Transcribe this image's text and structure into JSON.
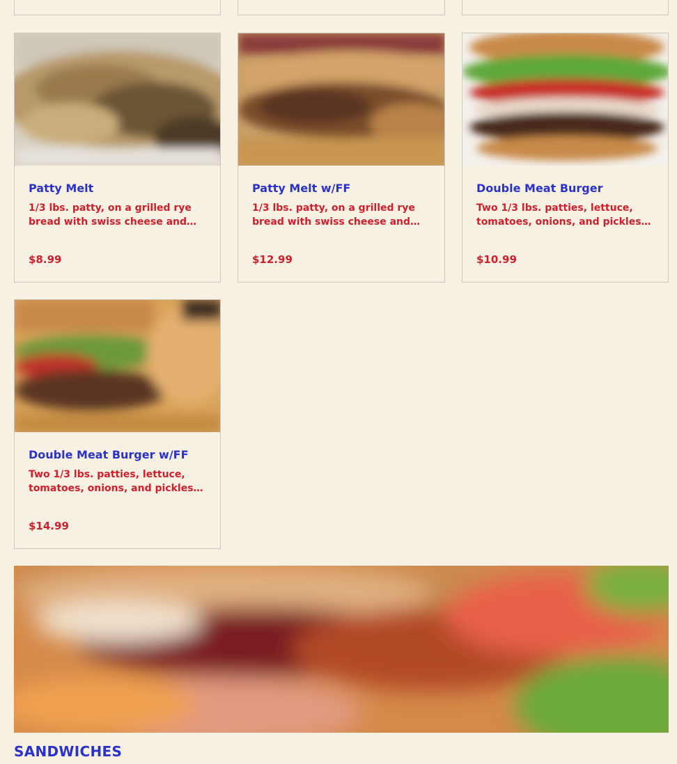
{
  "items": [
    {
      "name": "Patty Melt",
      "description": "1/3 lbs. patty, on a grilled rye bread with swiss cheese and grilled onions.",
      "price": "$8.99",
      "image": "patty-melt-photo"
    },
    {
      "name": "Patty Melt w/FF",
      "description": "1/3 lbs. patty, on a grilled rye bread with swiss cheese and grilled onions.",
      "price": "$12.99",
      "image": "patty-melt-fries-photo"
    },
    {
      "name": "Double Meat Burger",
      "description": "Two 1/3 lbs. patties, lettuce, tomatoes, onions, and pickles on a bun.",
      "price": "$10.99",
      "image": "double-meat-burger-photo"
    },
    {
      "name": "Double Meat Burger w/FF",
      "description": "Two 1/3 lbs. patties, lettuce, tomatoes, onions, and pickles on a bun.",
      "price": "$14.99",
      "image": "double-meat-burger-fries-photo"
    }
  ],
  "section": {
    "title": "SANDWICHES",
    "banner_image": "sandwich-banner-photo"
  },
  "colors": {
    "background": "#f7f1e3",
    "title": "#2b32c9",
    "accent": "#d01f2b",
    "border": "#cfc6bb"
  }
}
